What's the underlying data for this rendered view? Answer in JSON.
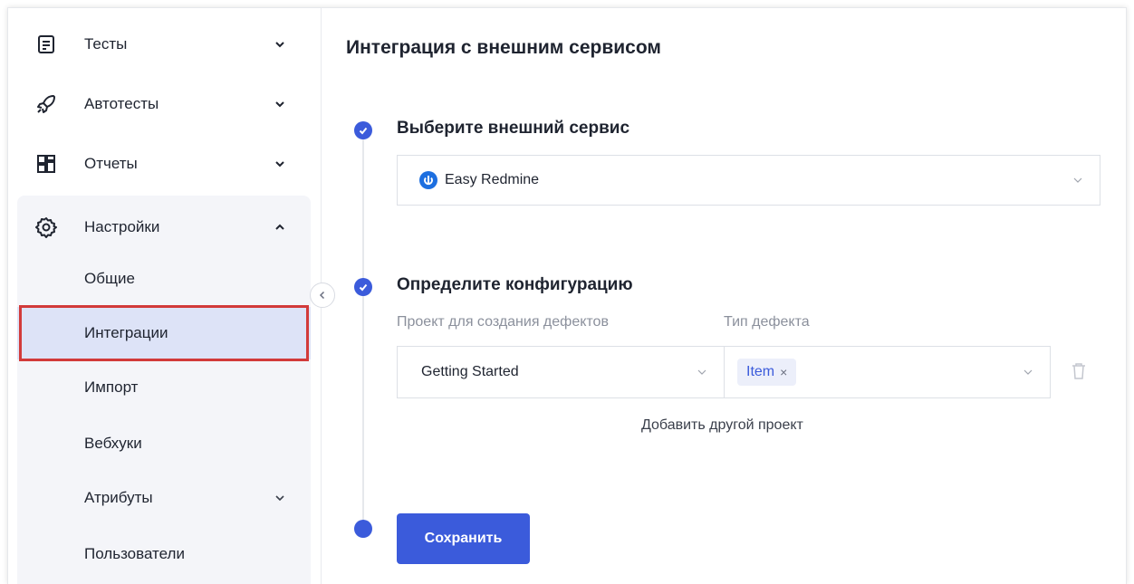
{
  "sidebar": {
    "items": [
      {
        "label": "Тесты",
        "icon": "document-icon"
      },
      {
        "label": "Автотесты",
        "icon": "rocket-icon"
      },
      {
        "label": "Отчеты",
        "icon": "dashboard-icon"
      },
      {
        "label": "Настройки",
        "icon": "gear-icon"
      }
    ],
    "settings_children": [
      {
        "label": "Общие"
      },
      {
        "label": "Интеграции"
      },
      {
        "label": "Импорт"
      },
      {
        "label": "Вебхуки"
      },
      {
        "label": "Атрибуты"
      },
      {
        "label": "Пользователи"
      }
    ]
  },
  "main": {
    "title": "Интеграция с внешним сервисом",
    "step1": {
      "title": "Выберите внешний сервис",
      "service_value": "Easy Redmine"
    },
    "step2": {
      "title": "Определите конфигурацию",
      "project_label": "Проект для создания дефектов",
      "defect_type_label": "Тип дефекта",
      "project_value": "Getting Started",
      "defect_tag": "Item",
      "tag_remove": "×",
      "add_project": "Добавить другой проект"
    },
    "save_label": "Сохранить"
  },
  "colors": {
    "accent": "#3b5bdb",
    "active_bg": "#dde3f7",
    "group_bg": "#f4f5f9",
    "highlight": "#d23a3a"
  }
}
